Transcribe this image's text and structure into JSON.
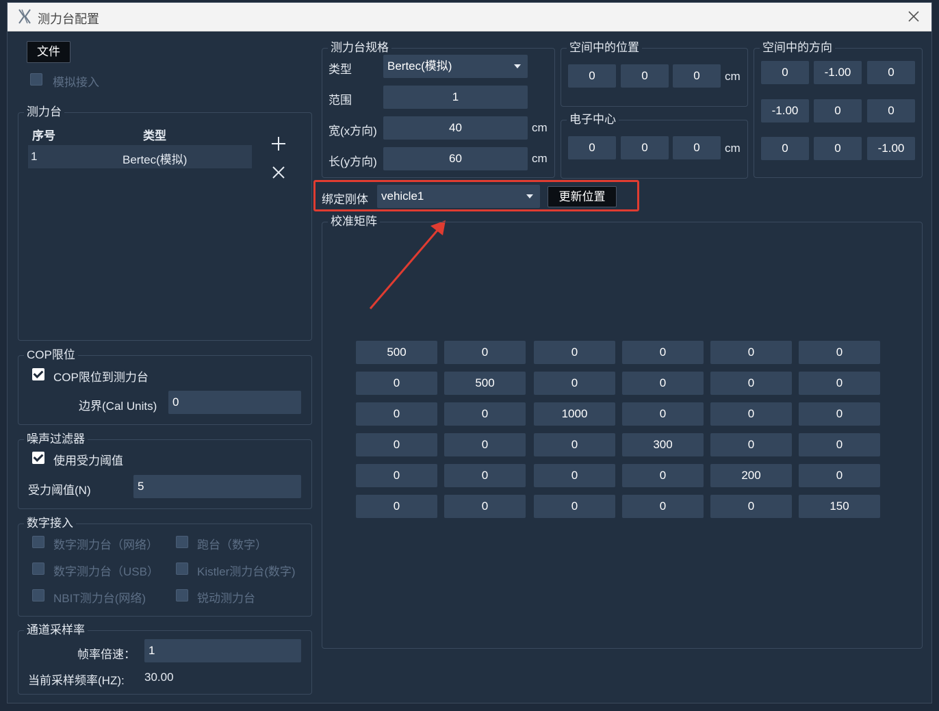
{
  "window": {
    "title": "测力台配置"
  },
  "toolbar": {
    "file_label": "文件",
    "simulate_label": "模拟接入"
  },
  "plates": {
    "title": "测力台",
    "col_index": "序号",
    "col_type": "类型",
    "rows": [
      {
        "index": "1",
        "type": "Bertec(模拟)"
      }
    ]
  },
  "cop": {
    "title": "COP限位",
    "limit_label": "COP限位到测力台",
    "border_label": "边界(Cal Units)",
    "border_value": "0"
  },
  "noise": {
    "title": "噪声过滤器",
    "use_label": "使用受力阈值",
    "threshold_label": "受力阈值(N)",
    "threshold_value": "5"
  },
  "digital": {
    "title": "数字接入",
    "items": [
      "数字测力台（网络）",
      "跑台（数字）",
      "数字测力台（USB）",
      "Kistler测力台(数字)",
      "NBIT测力台(网络)",
      "锐动测力台"
    ]
  },
  "sampling": {
    "title": "通道采样率",
    "rate_label": "帧率倍速：",
    "rate_value": "1",
    "current_label": "当前采样频率(HZ):",
    "current_value": "30.00"
  },
  "spec": {
    "title": "测力台规格",
    "type_label": "类型",
    "type_value": "Bertec(模拟)",
    "range_label": "范围",
    "range_value": "1",
    "width_label": "宽(x方向)",
    "width_value": "40",
    "length_label": "长(y方向)",
    "length_value": "60",
    "unit": "cm"
  },
  "position": {
    "title": "空间中的位置",
    "values": [
      "0",
      "0",
      "0"
    ],
    "unit": "cm"
  },
  "center": {
    "title": "电子中心",
    "values": [
      "0",
      "0",
      "0"
    ],
    "unit": "cm"
  },
  "orientation": {
    "title": "空间中的方向",
    "rows": [
      [
        "0",
        "-1.00",
        "0"
      ],
      [
        "-1.00",
        "0",
        "0"
      ],
      [
        "0",
        "0",
        "-1.00"
      ]
    ]
  },
  "bind": {
    "label": "绑定刚体",
    "value": "vehicle1",
    "update_label": "更新位置"
  },
  "calibration": {
    "title": "校准矩阵",
    "rows": [
      [
        "500",
        "0",
        "0",
        "0",
        "0",
        "0"
      ],
      [
        "0",
        "500",
        "0",
        "0",
        "0",
        "0"
      ],
      [
        "0",
        "0",
        "1000",
        "0",
        "0",
        "0"
      ],
      [
        "0",
        "0",
        "0",
        "300",
        "0",
        "0"
      ],
      [
        "0",
        "0",
        "0",
        "0",
        "200",
        "0"
      ],
      [
        "0",
        "0",
        "0",
        "0",
        "0",
        "150"
      ]
    ]
  },
  "colors": {
    "highlight": "#e03c31",
    "panel": "#223041",
    "field": "#34465c"
  }
}
